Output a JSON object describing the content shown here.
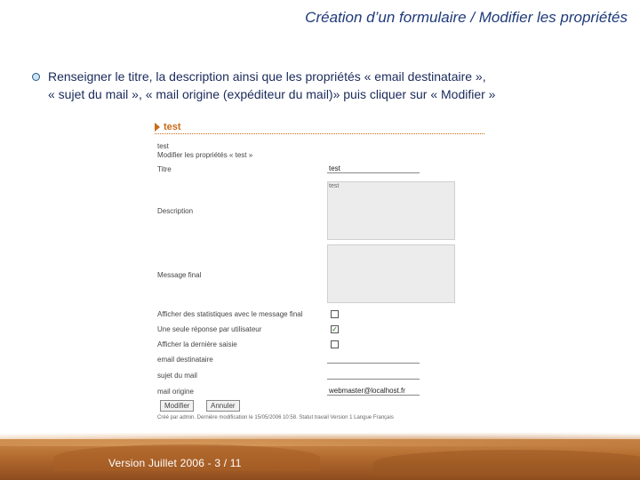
{
  "slide": {
    "title": "Création d’un formulaire / Modifier les propriétés",
    "bullet_line1": "Renseigner le titre, la description ainsi que les propriétés « email destinataire »,",
    "bullet_line2": "« sujet du mail », « mail origine (expéditeur du mail)» puis cliquer sur « Modifier »",
    "footer": "Version Juillet 2006 - 3 / 11"
  },
  "screenshot": {
    "heading": "test",
    "breadcrumb": "test",
    "subtitle": "Modifier les propriétés « test »",
    "fields": {
      "titre_label": "Titre",
      "titre_value": "test",
      "description_label": "Description",
      "description_value": "test",
      "message_label": "Message final",
      "stats_label": "Afficher des statistiques avec le message final",
      "one_reply_label": "Une seule réponse par utilisateur",
      "last_entry_label": "Afficher la dernière saisie",
      "email_label": "email destinataire",
      "subject_label": "sujet du mail",
      "origin_label": "mail origine",
      "origin_value": "webmaster@localhost.fr"
    },
    "checkboxes": {
      "stats": false,
      "one_reply": true,
      "last_entry": false
    },
    "buttons": {
      "modify": "Modifier",
      "cancel": "Annuler"
    },
    "footer_note": "Créé par admin. Dernière modification le 15/05/2006 10:58. Statut travail Version 1 Langue Français"
  },
  "colors": {
    "title": "#1f3a7a",
    "accent": "#c86b1a"
  }
}
